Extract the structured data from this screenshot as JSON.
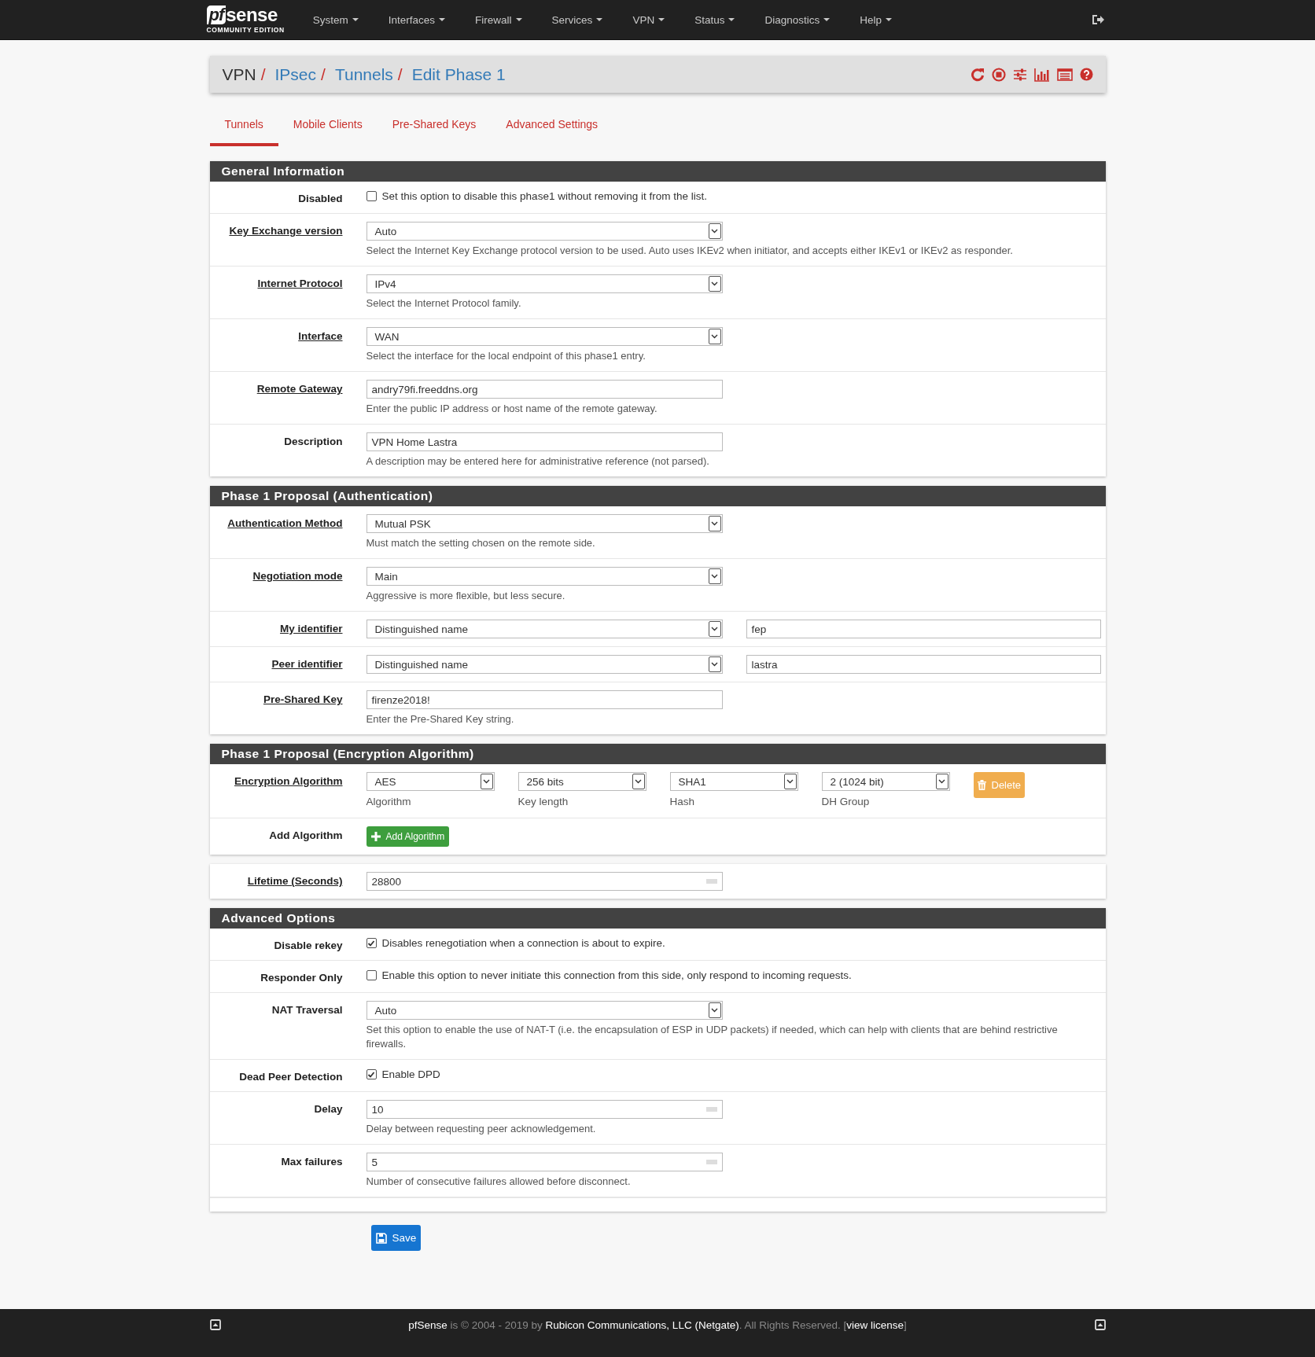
{
  "navbar": {
    "logo": {
      "badge": "pf",
      "name": "sense",
      "tagline": "COMMUNITY EDITION"
    },
    "menu": [
      {
        "label": "System"
      },
      {
        "label": "Interfaces"
      },
      {
        "label": "Firewall"
      },
      {
        "label": "Services"
      },
      {
        "label": "VPN"
      },
      {
        "label": "Status"
      },
      {
        "label": "Diagnostics"
      },
      {
        "label": "Help"
      }
    ]
  },
  "breadcrumb": [
    {
      "label": "VPN",
      "kind": "plain",
      "separator": "/"
    },
    {
      "label": "IPsec",
      "kind": "link",
      "separator": "/"
    },
    {
      "label": "Tunnels",
      "kind": "link",
      "separator": "/"
    },
    {
      "label": "Edit Phase 1",
      "kind": "link"
    }
  ],
  "tabs": [
    {
      "label": "Tunnels",
      "selected": true
    },
    {
      "label": "Mobile Clients",
      "selected": false
    },
    {
      "label": "Pre-Shared Keys",
      "selected": false
    },
    {
      "label": "Advanced Settings",
      "selected": false
    }
  ],
  "sections": [
    {
      "title": "General Information",
      "rows": [
        {
          "label": "Disabled",
          "underlined": false,
          "kind": "checkbox",
          "checked": false,
          "text": "Set this option to disable this phase1 without removing it from the list."
        },
        {
          "label": "Key Exchange version",
          "underlined": true,
          "kind": "select",
          "value": "Auto",
          "help": "Select the Internet Key Exchange protocol version to be used. Auto uses IKEv2 when initiator, and accepts either IKEv1 or IKEv2 as responder."
        },
        {
          "label": "Internet Protocol",
          "underlined": true,
          "kind": "select",
          "value": "IPv4",
          "help": "Select the Internet Protocol family."
        },
        {
          "label": "Interface",
          "underlined": true,
          "kind": "select",
          "value": "WAN",
          "help": "Select the interface for the local endpoint of this phase1 entry."
        },
        {
          "label": "Remote Gateway",
          "underlined": true,
          "kind": "input",
          "value": "andry79fi.freeddns.org",
          "help": "Enter the public IP address or host name of the remote gateway."
        },
        {
          "label": "Description",
          "underlined": false,
          "kind": "input",
          "value": "VPN Home Lastra",
          "help": "A description may be entered here for administrative reference (not parsed)."
        }
      ]
    },
    {
      "title": "Phase 1 Proposal (Authentication)",
      "rows": [
        {
          "label": "Authentication Method",
          "underlined": true,
          "kind": "select",
          "value": "Mutual PSK",
          "help": "Must match the setting chosen on the remote side."
        },
        {
          "label": "Negotiation mode",
          "underlined": true,
          "kind": "select",
          "value": "Main",
          "help": "Aggressive is more flexible, but less secure."
        },
        {
          "label": "My identifier",
          "underlined": true,
          "kind": "identifier",
          "value": "Distinguished name",
          "value_2": "fep"
        },
        {
          "label": "Peer identifier",
          "underlined": true,
          "kind": "identifier",
          "value": "Distinguished name",
          "value_2": "lastra"
        },
        {
          "label": "Pre-Shared Key",
          "underlined": true,
          "kind": "input",
          "value": "firenze2018!",
          "help": "Enter the Pre-Shared Key string."
        }
      ]
    },
    {
      "title": "Phase 1 Proposal (Encryption Algorithm)",
      "rows": [
        {
          "label": "Encryption Algorithm",
          "underlined": true,
          "kind": "encryption",
          "button": "Delete",
          "fields": [
            {
              "value": "AES",
              "caption": "Algorithm"
            },
            {
              "value": "256 bits",
              "caption": "Key length"
            },
            {
              "value": "SHA1",
              "caption": "Hash"
            },
            {
              "value": "2 (1024 bit)",
              "caption": "DH Group"
            }
          ]
        },
        {
          "label": "Add Algorithm",
          "underlined": false,
          "kind": "button",
          "button": "Add Algorithm"
        }
      ]
    },
    {
      "rows": [
        {
          "label": "Lifetime (Seconds)",
          "underlined": true,
          "kind": "number",
          "value": "28800"
        }
      ]
    },
    {
      "title": "Advanced Options",
      "rows": [
        {
          "label": "Disable rekey",
          "underlined": false,
          "kind": "checkbox",
          "checked": true,
          "text": "Disables renegotiation when a connection is about to expire."
        },
        {
          "label": "Responder Only",
          "underlined": false,
          "kind": "checkbox",
          "checked": false,
          "text": "Enable this option to never initiate this connection from this side, only respond to incoming requests."
        },
        {
          "label": "NAT Traversal",
          "underlined": false,
          "kind": "select",
          "value": "Auto",
          "help": "Set this option to enable the use of NAT-T (i.e. the encapsulation of ESP in UDP packets) if needed, which can help with clients that are behind restrictive firewalls."
        },
        {
          "label": "Dead Peer Detection",
          "underlined": false,
          "kind": "checkbox",
          "checked": true,
          "text": "Enable DPD"
        },
        {
          "label": "Delay",
          "underlined": false,
          "kind": "number",
          "value": "10",
          "help": "Delay between requesting peer acknowledgement."
        },
        {
          "label": "Max failures",
          "underlined": false,
          "kind": "number",
          "value": "5",
          "help": "Number of consecutive failures allowed before disconnect."
        }
      ]
    }
  ],
  "save_button": "Save",
  "footer": [
    {
      "text": "pfSense",
      "kind": "link"
    },
    {
      "text": " is © 2004 - 2019 by ",
      "kind": "text"
    },
    {
      "text": "Rubicon Communications, LLC (Netgate)",
      "kind": "link"
    },
    {
      "text": ". All Rights Reserved. [",
      "kind": "text"
    },
    {
      "text": "view license",
      "kind": "link"
    },
    {
      "text": "]",
      "kind": "text"
    }
  ]
}
